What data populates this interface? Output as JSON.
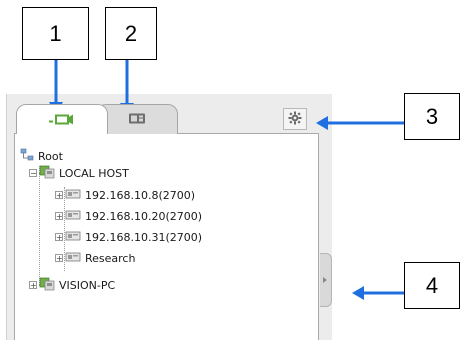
{
  "callouts": {
    "c1": "1",
    "c2": "2",
    "c3": "3",
    "c4": "4"
  },
  "tree": {
    "root": "Root",
    "local_host": "LOCAL HOST",
    "items": [
      "192.168.10.8(2700)",
      "192.168.10.20(2700)",
      "192.168.10.31(2700)",
      "Research"
    ],
    "vision_pc": "VISION-PC"
  },
  "icons": {
    "tab1": "camera-tab-icon",
    "tab2": "recorder-tab-icon",
    "settings": "gear-icon",
    "handle": "collapse-handle-icon"
  },
  "colors": {
    "arrow": "#1f6fe0",
    "tab_icon_green": "#5aa83a"
  }
}
